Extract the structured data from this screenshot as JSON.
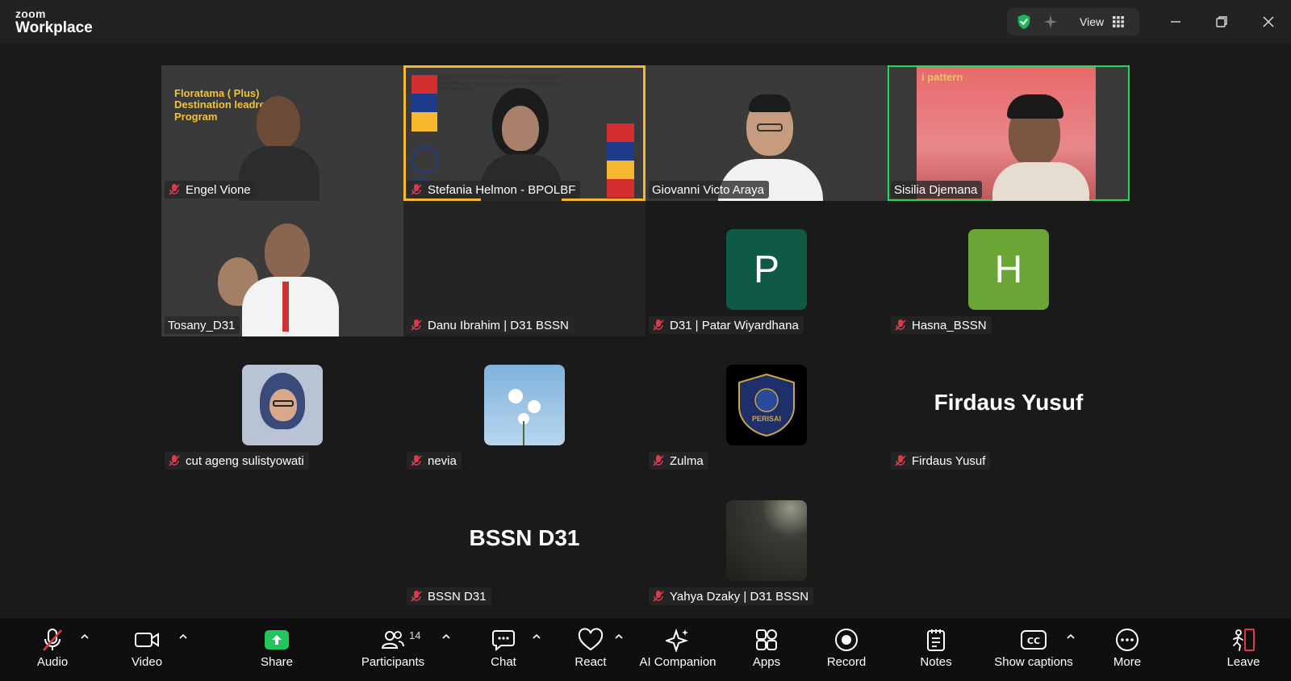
{
  "window": {
    "brand_top": "zoom",
    "brand_bottom": "Workplace",
    "view_label": "View"
  },
  "participants": [
    {
      "name": "Engel Vione",
      "muted": true,
      "kind": "video"
    },
    {
      "name": "Stefania Helmon - BPOLBF",
      "muted": true,
      "kind": "video"
    },
    {
      "name": "Giovanni Victo Araya",
      "muted": false,
      "kind": "video"
    },
    {
      "name": "Sisilia Djemana",
      "muted": false,
      "kind": "video"
    },
    {
      "name": "Tosany_D31",
      "muted": false,
      "kind": "video"
    },
    {
      "name": "Danu Ibrahim | D31 BSSN",
      "muted": true,
      "kind": "off"
    },
    {
      "name": "D31 | Patar Wiyardhana",
      "muted": true,
      "kind": "avatar",
      "initial": "P",
      "color": "#0e5a45"
    },
    {
      "name": "Hasna_BSSN",
      "muted": true,
      "kind": "avatar",
      "initial": "H",
      "color": "#6aa535"
    },
    {
      "name": "cut ageng sulistyowati",
      "muted": true,
      "kind": "photo"
    },
    {
      "name": "nevia",
      "muted": true,
      "kind": "photo"
    },
    {
      "name": "Zulma",
      "muted": true,
      "kind": "photo"
    },
    {
      "name": "Firdaus Yusuf",
      "muted": true,
      "kind": "text",
      "display": "Firdaus Yusuf"
    },
    {
      "name": "BSSN D31",
      "muted": true,
      "kind": "text",
      "display": "BSSN D31"
    },
    {
      "name": "Yahya Dzaky | D31 BSSN",
      "muted": true,
      "kind": "photo"
    }
  ],
  "video_text": {
    "slide1": "Floratama ( Plus) Destination leadre Program",
    "slide2": "MONITORING DAN EVALUASI PENGELOLAAN INFORMASI DI LINGKUNGAN KEMENTERIAN PARIWISATA",
    "slide2_tag": "PPID",
    "slide4": "i pattern",
    "zulma_logo": "PERISAI"
  },
  "toolbar": {
    "audio": "Audio",
    "video": "Video",
    "share": "Share",
    "participants": "Participants",
    "participants_count": "14",
    "chat": "Chat",
    "react": "React",
    "ai": "AI Companion",
    "apps": "Apps",
    "record": "Record",
    "notes": "Notes",
    "captions": "Show captions",
    "more": "More",
    "leave": "Leave"
  },
  "colors": {
    "active_speaker": "#23d959",
    "spotlight": "#f5b82e",
    "muted_red": "#e0384a",
    "share_green": "#22c55e",
    "leave_red": "#e0384a"
  }
}
